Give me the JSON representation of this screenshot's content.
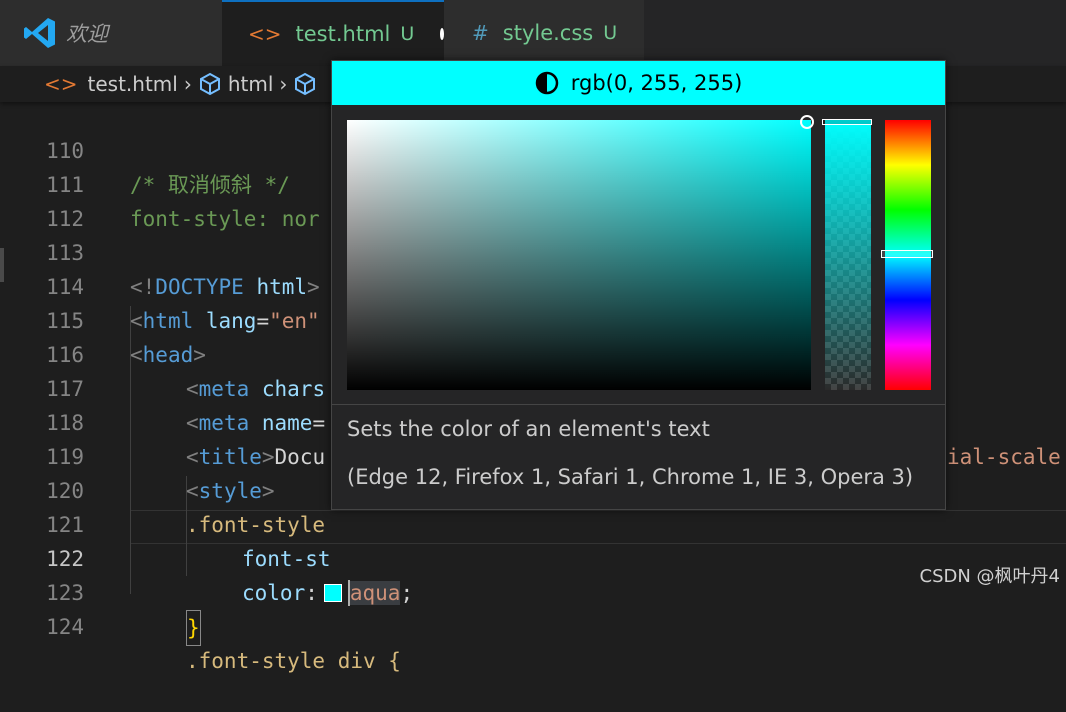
{
  "tabs": [
    {
      "label": "欢迎",
      "icon": "vscode-logo-icon",
      "active": false
    },
    {
      "label": "test.html",
      "icon": "html-brackets-icon",
      "status": "U",
      "modified": true,
      "active": true
    },
    {
      "label": "style.css",
      "icon": "hash-icon",
      "status": "U",
      "active": false
    }
  ],
  "tab_icons": {
    "html": "<>",
    "css": "#"
  },
  "breadcrumb": {
    "file": "test.html",
    "element": "html"
  },
  "lines": [
    {
      "n": "110"
    },
    {
      "n": "111"
    },
    {
      "n": "112"
    },
    {
      "n": "113"
    },
    {
      "n": "114"
    },
    {
      "n": "115"
    },
    {
      "n": "116"
    },
    {
      "n": "117"
    },
    {
      "n": "118"
    },
    {
      "n": "119"
    },
    {
      "n": "120"
    },
    {
      "n": "121"
    },
    {
      "n": "122"
    },
    {
      "n": "123"
    },
    {
      "n": "124"
    }
  ],
  "code": {
    "l110": "/* 取消倾斜 */",
    "l111_prop": "font-style",
    "l111_rest": ": nor",
    "l113_a": "<!",
    "l113_b": "DOCTYPE",
    "l113_c": " html",
    "l113_d": ">",
    "l114_a": "<",
    "l114_b": "html",
    "l114_c": " lang",
    "l114_d": "=",
    "l114_e": "\"en\"",
    "l115_a": "<",
    "l115_b": "head",
    "l115_c": ">",
    "l116_a": "<",
    "l116_b": "meta",
    "l116_c": " chars",
    "l117_a": "<",
    "l117_b": "meta",
    "l117_c": " name",
    "l117_d": "=",
    "l117_tail": "ial-scale",
    "l118_a": "<",
    "l118_b": "title",
    "l118_c": ">",
    "l118_d": "Docu",
    "l119_a": "<",
    "l119_b": "style",
    "l119_c": ">",
    "l120": ".font-style",
    "l121": "font-st",
    "l122_prop": "color",
    "l122_colon": ":",
    "l122_val": "aqua",
    "l122_semi": ";",
    "l123": "}",
    "l124": ".font-style div {"
  },
  "color_picker": {
    "value_label": "rgb(0, 255, 255)",
    "color": "#00ffff",
    "description": "Sets the color of an element's text",
    "compatibility": "(Edge 12, Firefox 1, Safari 1, Chrome 1, IE 3, Opera 3)"
  },
  "watermark": "CSDN @枫叶丹4"
}
